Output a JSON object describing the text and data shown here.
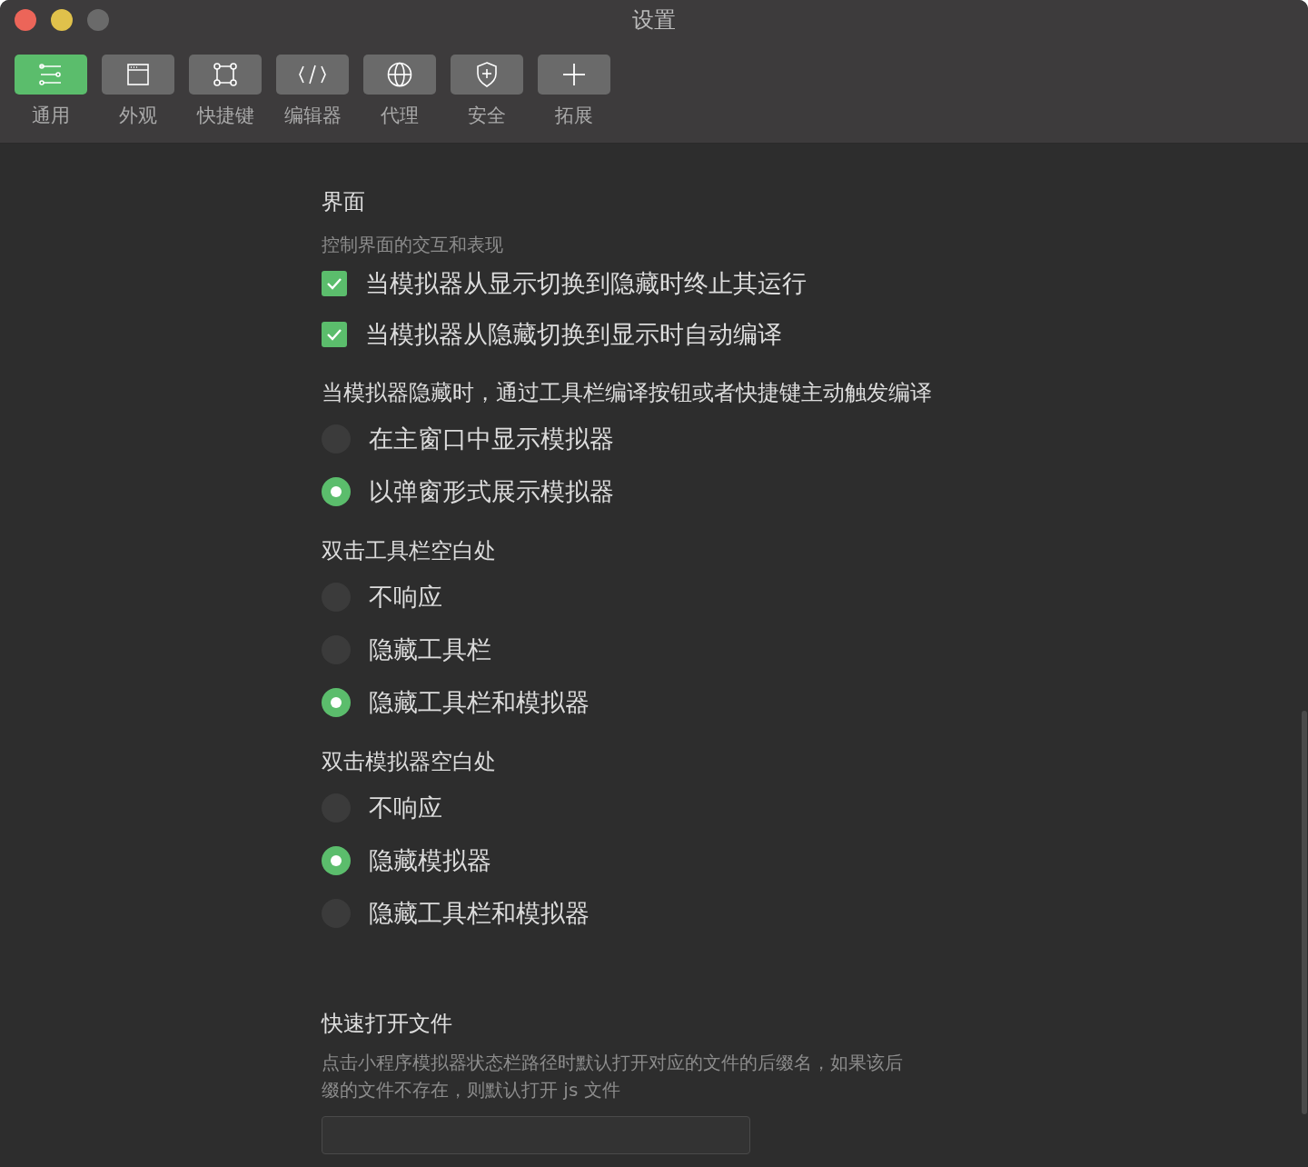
{
  "window": {
    "title": "设置"
  },
  "toolbar": {
    "tabs": [
      {
        "label": "通用",
        "kind": "sliders",
        "selected": true
      },
      {
        "label": "外观",
        "kind": "window",
        "selected": false
      },
      {
        "label": "快捷键",
        "kind": "command",
        "selected": false
      },
      {
        "label": "编辑器",
        "kind": "code",
        "selected": false
      },
      {
        "label": "代理",
        "kind": "globe",
        "selected": false
      },
      {
        "label": "安全",
        "kind": "shield",
        "selected": false
      },
      {
        "label": "拓展",
        "kind": "plus",
        "selected": false
      }
    ]
  },
  "sections": [
    {
      "kind": "options",
      "title": "界面",
      "description": "控制界面的交互和表现",
      "checkboxes": [
        {
          "label": "当模拟器从显示切换到隐藏时终止其运行",
          "checked": true
        },
        {
          "label": "当模拟器从隐藏切换到显示时自动编译",
          "checked": true
        }
      ],
      "groups": [
        {
          "label": "当模拟器隐藏时，通过工具栏编译按钮或者快捷键主动触发编译",
          "options": [
            {
              "label": "在主窗口中显示模拟器",
              "selected": false
            },
            {
              "label": "以弹窗形式展示模拟器",
              "selected": true
            }
          ]
        },
        {
          "label": "双击工具栏空白处",
          "options": [
            {
              "label": "不响应",
              "selected": false
            },
            {
              "label": "隐藏工具栏",
              "selected": false
            },
            {
              "label": "隐藏工具栏和模拟器",
              "selected": true
            }
          ]
        },
        {
          "label": "双击模拟器空白处",
          "options": [
            {
              "label": "不响应",
              "selected": false
            },
            {
              "label": "隐藏模拟器",
              "selected": true
            },
            {
              "label": "隐藏工具栏和模拟器",
              "selected": false
            }
          ]
        }
      ]
    },
    {
      "kind": "input",
      "title": "快速打开文件",
      "description": "点击小程序模拟器状态栏路径时默认打开对应的文件的后缀名，如果该后缀的文件不存在，则默认打开 js 文件"
    }
  ]
}
